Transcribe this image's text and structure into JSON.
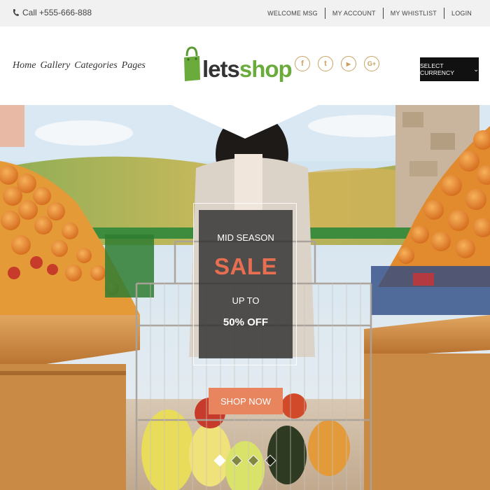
{
  "topbar": {
    "phone": "Call +555-666-888",
    "links": [
      "WELCOME MSG",
      "MY ACCOUNT",
      "MY WHISTLIST",
      "LOGIN"
    ]
  },
  "nav": {
    "items": [
      "Home",
      "Gallery",
      "Categories",
      "Pages"
    ]
  },
  "logo": {
    "part1": "lets",
    "part2": "shop"
  },
  "socials": [
    {
      "name": "facebook-icon",
      "glyph": "f"
    },
    {
      "name": "twitter-icon",
      "glyph": "t"
    },
    {
      "name": "youtube-icon",
      "glyph": "▶"
    },
    {
      "name": "google-plus-icon",
      "glyph": "G+"
    }
  ],
  "currency": {
    "label": "SELECT CURRENCY",
    "chevron": "⌄"
  },
  "promo": {
    "line1": "MID SEASON",
    "line2": "SALE",
    "line3": "UP TO",
    "line4": "50% OFF",
    "cta": "SHOP NOW"
  },
  "slider": {
    "active_slide": 1,
    "total_slides": 4
  },
  "colors": {
    "accent_green": "#6aab3c",
    "sale_orange": "#e86e52",
    "cta_orange": "#e8845e",
    "social_gold": "#c9a15f"
  }
}
